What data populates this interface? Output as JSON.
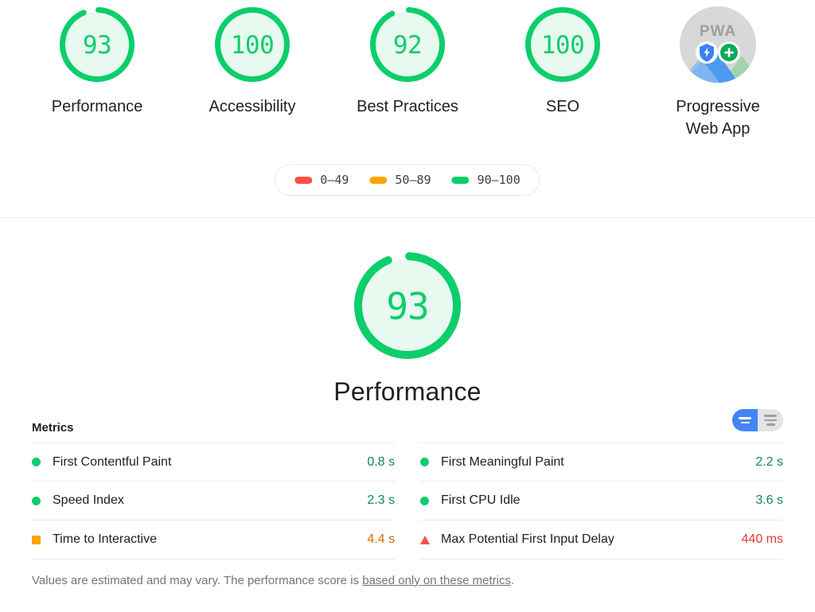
{
  "summary": {
    "gauges": [
      {
        "score": "93",
        "label": "Performance",
        "pct": 93,
        "color": "#0CCE6B",
        "track": "#E8F9F0",
        "type": "gauge"
      },
      {
        "score": "100",
        "label": "Accessibility",
        "pct": 100,
        "color": "#0CCE6B",
        "track": "#E8F9F0",
        "type": "gauge"
      },
      {
        "score": "92",
        "label": "Best Practices",
        "pct": 92,
        "color": "#0CCE6B",
        "track": "#E8F9F0",
        "type": "gauge"
      },
      {
        "score": "100",
        "label": "SEO",
        "pct": 100,
        "color": "#0CCE6B",
        "track": "#E8F9F0",
        "type": "gauge"
      },
      {
        "score": "",
        "label": "Progressive Web App",
        "pct": 0,
        "color": "#d8d8d8",
        "track": "#d8d8d8",
        "type": "pwa",
        "badge_text": "PWA"
      }
    ],
    "legend": [
      {
        "swatch_color": "#FF4E42",
        "range": "0–49"
      },
      {
        "swatch_color": "#FFA400",
        "range": "50–89"
      },
      {
        "swatch_color": "#0CCE6B",
        "range": "90–100"
      }
    ]
  },
  "category": {
    "score": "93",
    "title": "Performance",
    "pct": 93,
    "color": "#0CCE6B",
    "track": "#E8F9F0"
  },
  "metrics": {
    "title": "Metrics",
    "toggle": {
      "active_option": "simple-view",
      "options": [
        {
          "name": "simple-view",
          "active": true
        },
        {
          "name": "detailed-view",
          "active": false
        }
      ]
    },
    "left_column": [
      {
        "status": "pass",
        "name": "First Contentful Paint",
        "value": "0.8 s"
      },
      {
        "status": "pass",
        "name": "Speed Index",
        "value": "2.3 s"
      },
      {
        "status": "average",
        "name": "Time to Interactive",
        "value": "4.4 s"
      }
    ],
    "right_column": [
      {
        "status": "pass",
        "name": "First Meaningful Paint",
        "value": "2.2 s"
      },
      {
        "status": "pass",
        "name": "First CPU Idle",
        "value": "3.6 s"
      },
      {
        "status": "fail",
        "name": "Max Potential First Input Delay",
        "value": "440 ms"
      }
    ],
    "note_before": "Values are estimated and may vary. The performance score is ",
    "note_link": "based only on these metrics",
    "note_after": "."
  },
  "colors": {
    "pass": "#0CCE6B",
    "average": "#FFA400",
    "fail": "#FF4E42",
    "accent_blue": "#4285F4",
    "pwa_gray": "#d8d8d8"
  }
}
